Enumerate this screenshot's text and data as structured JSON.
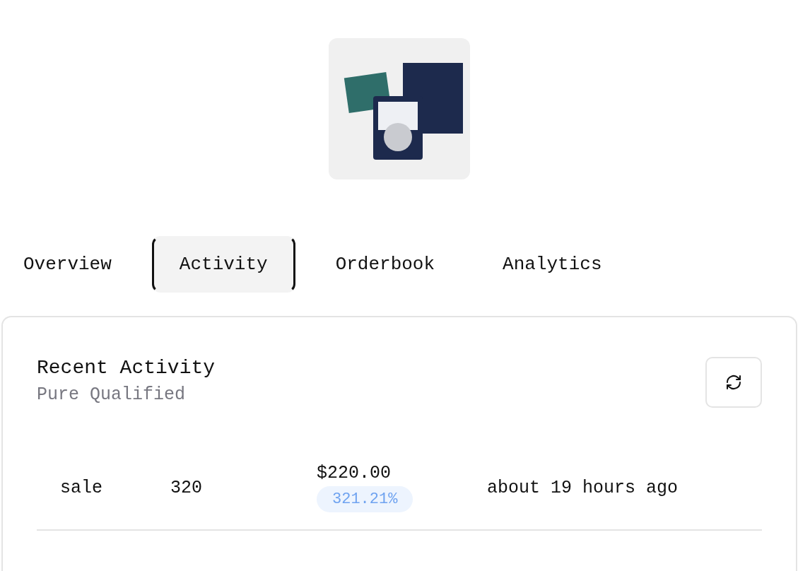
{
  "tabs": [
    {
      "label": "Overview",
      "selected": false
    },
    {
      "label": "Activity",
      "selected": true
    },
    {
      "label": "Orderbook",
      "selected": false
    },
    {
      "label": "Analytics",
      "selected": false
    }
  ],
  "activity": {
    "title": "Recent Activity",
    "subtitle": "Pure Qualified",
    "rows": [
      {
        "type": "sale",
        "quantity": "320",
        "price": "$220.00",
        "change": "321.21%",
        "time": "about 19 hours ago"
      }
    ]
  }
}
